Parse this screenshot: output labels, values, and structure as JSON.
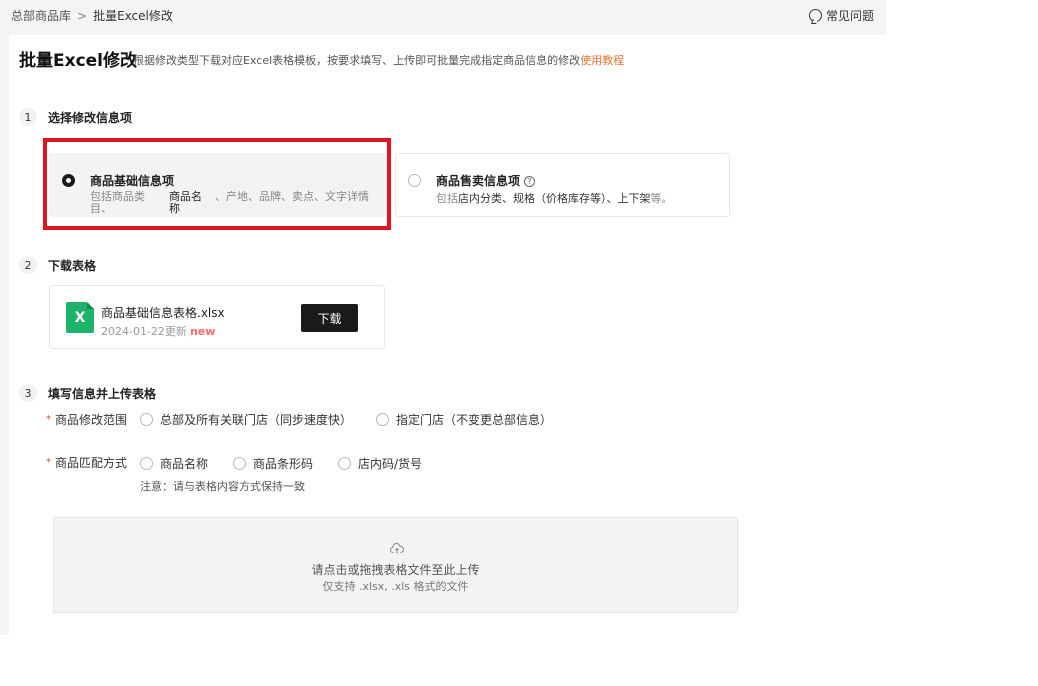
{
  "breadcrumb": {
    "root": "总部商品库",
    "separator": ">",
    "current": "批量Excel修改"
  },
  "faq_label": "常见问题",
  "header": {
    "title": "批量Excel修改",
    "description": "根据修改类型下载对应Excel表格模板，按要求填写、上传即可批量完成指定商品信息的修改",
    "link": "使用教程"
  },
  "steps": [
    {
      "num": "1",
      "label": "选择修改信息项"
    },
    {
      "num": "2",
      "label": "下载表格"
    },
    {
      "num": "3",
      "label": "填写信息并上传表格"
    }
  ],
  "info_options": [
    {
      "title": "商品基础信息项",
      "desc_a": "包括商品类目、",
      "desc_b": "商品名称",
      "desc_c": "、产地、品牌、卖点、文字详情",
      "selected": true
    },
    {
      "title": "商品售卖信息项",
      "desc_prefix": "包括",
      "desc_main": "店内分类、规格（价格库存等）、上下架",
      "desc_suffix": "等。",
      "selected": false
    }
  ],
  "file": {
    "name": "商品基础信息表格.xlsx",
    "date": "2024-01-22更新",
    "badge": "new",
    "icon_letter": "X",
    "download_label": "下载"
  },
  "scope": {
    "label": "商品修改范围",
    "options": [
      "总部及所有关联门店（同步速度快）",
      "指定门店（不变更总部信息）"
    ]
  },
  "match": {
    "label": "商品匹配方式",
    "options": [
      "商品名称",
      "商品条形码",
      "店内码/货号"
    ],
    "note": "注意：请与表格内容方式保持一致"
  },
  "upload": {
    "line1": "请点击或拖拽表格文件至此上传",
    "line2": "仅支持 .xlsx, .xls 格式的文件"
  },
  "colors": {
    "accent_link": "#e8742f",
    "highlight_box": "#e0141e",
    "excel_green": "#1fb26b",
    "new_badge": "#ff6a6a"
  }
}
